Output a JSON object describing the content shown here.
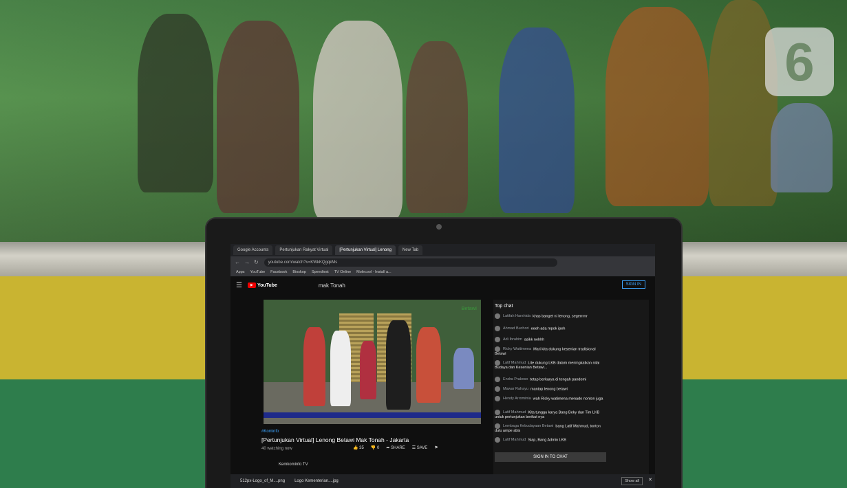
{
  "watermark": {
    "text": "6"
  },
  "browser": {
    "tabs": [
      {
        "label": "Google Accounts"
      },
      {
        "label": "Pertunjukan Rakyat Virtual"
      },
      {
        "label": "[Pertunjukan Virtual] Lenong"
      },
      {
        "label": "New Tab"
      }
    ],
    "url": "youtube.com/watch?v=KWkKQgqkMs",
    "bookmarks": [
      "Apps",
      "YouTube",
      "Facebook",
      "Bioskop",
      "Speedtest",
      "TV Online",
      "Molecool - Install a..."
    ]
  },
  "youtube": {
    "logo_text": "YouTube",
    "search_query": "mak Tonah",
    "sign_in": "SIGN IN",
    "hashtag": "#Kominfo",
    "video_title": "[Pertunjukan Virtual] Lenong Betawi Mak Tonah - Jakarta",
    "watching": "40 watching now",
    "likes": "35",
    "dislikes": "0",
    "share": "SHARE",
    "save": "SAVE",
    "channel": "Kemkominfo TV",
    "video_overlay_brand": "Betawi"
  },
  "chat": {
    "header": "Top chat",
    "messages": [
      {
        "author": "Latifah Harshida",
        "text": "khas banget ni lenong, segerrrrrr"
      },
      {
        "author": "Ahmad Buchori",
        "text": "eeeh ada mpok ipeh"
      },
      {
        "author": "Adi Ibrahim",
        "text": "asikk nehhh"
      },
      {
        "author": "Ricky Wattimena",
        "text": "Mari kita dukung kesenian tradisional Betawi"
      },
      {
        "author": "Latif Mahmud",
        "text": "Lite dukung LKB dalam meningkatkan nilai Budaya dan Kesenian Betawi..."
      },
      {
        "author": "Endra Prakoso",
        "text": "tetap berkarya di tengah pandemi"
      },
      {
        "author": "Mawar Rahayu",
        "text": "mantap lenong betawi"
      },
      {
        "author": "Hendy Arrominia",
        "text": "wah Ricky watimena menado nonton juga"
      },
      {
        "author": "Latif Mahmud",
        "text": "Kita tunggu karya Bang Beky dan Tim LKB untuk pertunjukan berikut nya"
      },
      {
        "author": "Lembaga Kebudayaan Betawi",
        "text": "bang Latif Mahmud, tonton dulu ampe abis"
      },
      {
        "author": "Latif Mahmud",
        "text": "Siap, Bang Admin LKB"
      }
    ],
    "sign_in_to_chat": "SIGN IN TO CHAT"
  },
  "downloads": {
    "items": [
      "512px-Logo_of_M....png",
      "Logo Kementerian....jpg"
    ],
    "show_all": "Show all"
  }
}
